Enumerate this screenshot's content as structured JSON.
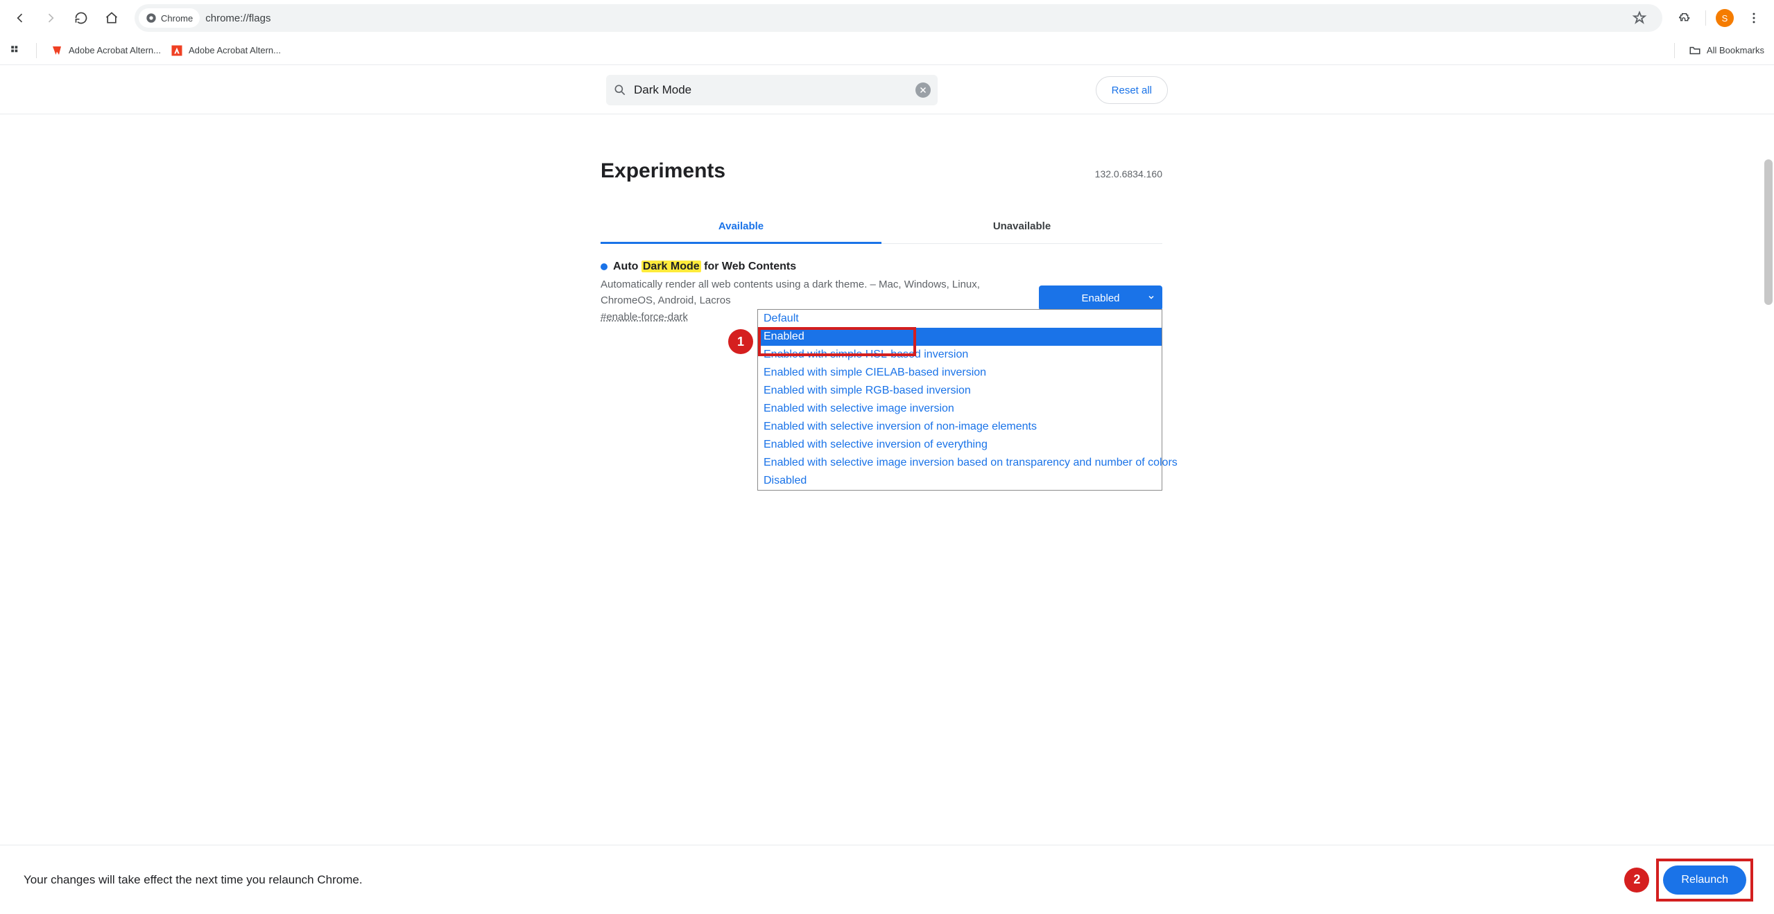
{
  "toolbar": {
    "chip_label": "Chrome",
    "url": "chrome://flags",
    "avatar_initial": "S"
  },
  "bookmarks": {
    "items": [
      {
        "label": "Adobe Acrobat Altern...",
        "icon": "adobe-a"
      },
      {
        "label": "Adobe Acrobat Altern...",
        "icon": "adobe-b"
      }
    ],
    "all_label": "All Bookmarks"
  },
  "header": {
    "search_value": "Dark Mode",
    "reset_label": "Reset all"
  },
  "page": {
    "title": "Experiments",
    "version": "132.0.6834.160",
    "tabs": {
      "available": "Available",
      "unavailable": "Unavailable"
    },
    "flag": {
      "title_pre": "Auto ",
      "title_hl": "Dark Mode",
      "title_post": " for Web Contents",
      "desc": "Automatically render all web contents using a dark theme. – Mac, Windows, Linux, ChromeOS, Android, Lacros",
      "hash": "#enable-force-dark",
      "selected": "Enabled",
      "options": [
        "Default",
        "Enabled",
        "Enabled with simple HSL-based inversion",
        "Enabled with simple CIELAB-based inversion",
        "Enabled with simple RGB-based inversion",
        "Enabled with selective image inversion",
        "Enabled with selective inversion of non-image elements",
        "Enabled with selective inversion of everything",
        "Enabled with selective image inversion based on transparency and number of colors",
        "Disabled"
      ]
    }
  },
  "footer": {
    "message": "Your changes will take effect the next time you relaunch Chrome.",
    "relaunch": "Relaunch"
  },
  "annotations": {
    "b1": "1",
    "b2": "2"
  }
}
